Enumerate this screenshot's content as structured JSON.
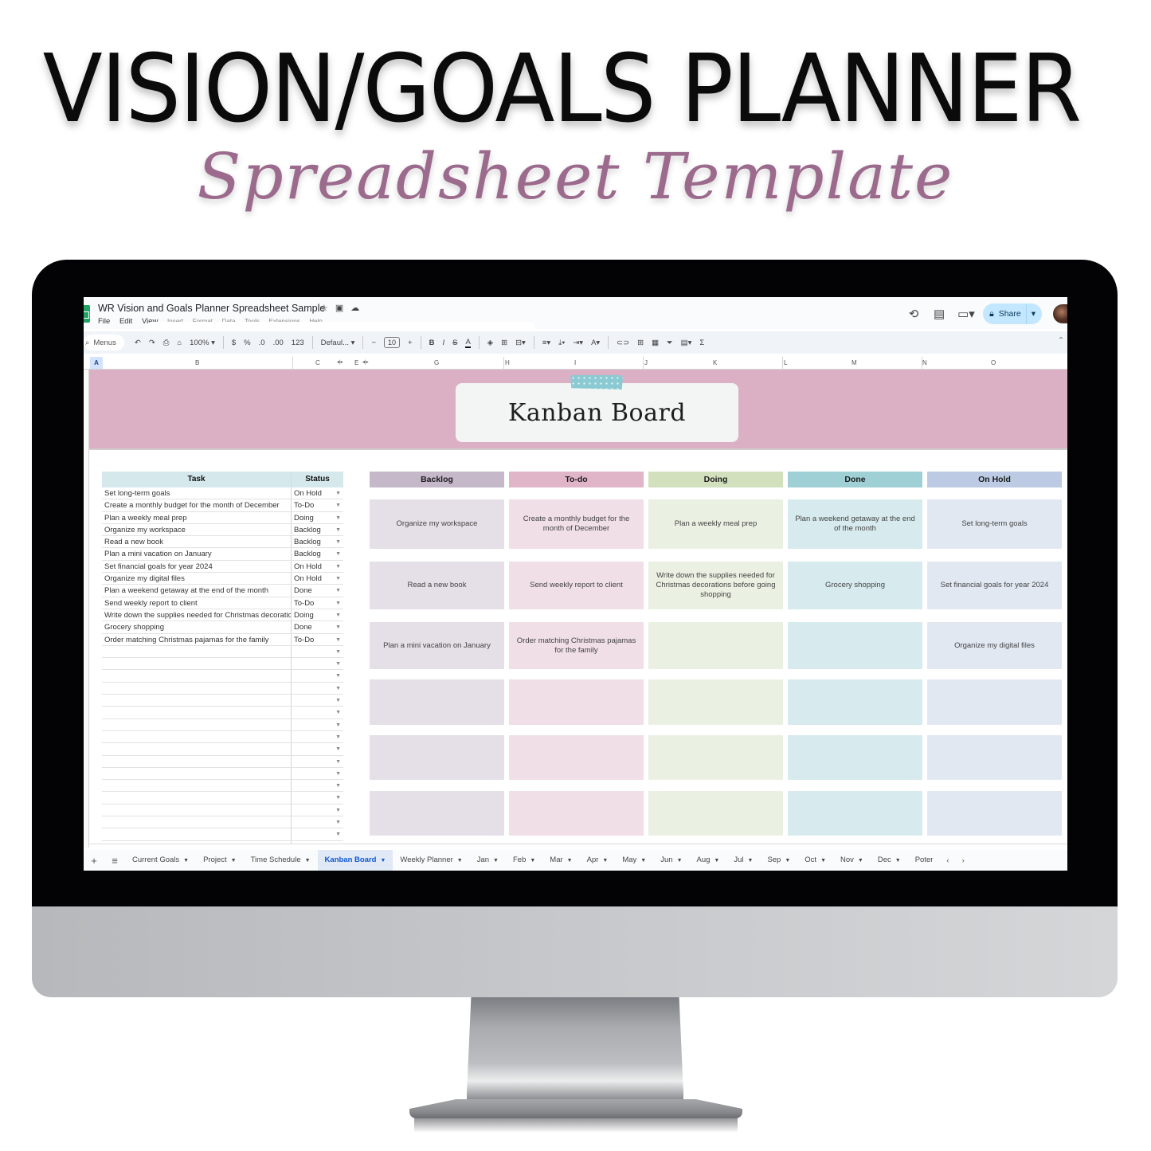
{
  "hero": {
    "title": "VISION/GOALS PLANNER",
    "subtitle": "Spreadsheet Template"
  },
  "app": {
    "doc_title": "WR Vision and Goals Planner Spreadsheet Sample",
    "title_icons": [
      "star-icon",
      "move-to-folder-icon",
      "cloud-status-icon"
    ],
    "menu": [
      "File",
      "Edit",
      "View",
      "Insert",
      "Format",
      "Data",
      "Tools",
      "Extensions",
      "Help"
    ],
    "share_label": "Share",
    "top_right_icons": [
      "version-history-icon",
      "comments-icon",
      "meet-icon"
    ]
  },
  "toolbar": {
    "search_label": "Menus",
    "zoom": "100%",
    "currency": "$",
    "percent": "%",
    "dec_decrease": ".0",
    "dec_increase": ".00",
    "number_format": "123",
    "font": "Defaul...",
    "font_size": "10",
    "bold": "B",
    "italic": "I",
    "strike": "S",
    "text_color": "A",
    "sigma": "Σ"
  },
  "columns": [
    "A",
    "B",
    "C",
    "E",
    "G",
    "H",
    "I",
    "J",
    "K",
    "L",
    "M",
    "N",
    "O"
  ],
  "banner": {
    "title": "Kanban Board",
    "bg_color": "#dcb0c4"
  },
  "task_table": {
    "headers": {
      "task": "Task",
      "status": "Status"
    },
    "rows": [
      {
        "task": "Set long-term goals",
        "status": "On Hold"
      },
      {
        "task": "Create a monthly budget for the month of December",
        "status": "To-Do"
      },
      {
        "task": "Plan a weekly meal prep",
        "status": "Doing"
      },
      {
        "task": "Organize my workspace",
        "status": "Backlog"
      },
      {
        "task": "Read a new book",
        "status": "Backlog"
      },
      {
        "task": "Plan a mini vacation on January",
        "status": "Backlog"
      },
      {
        "task": "Set financial goals for year 2024",
        "status": "On Hold"
      },
      {
        "task": "Organize my digital files",
        "status": "On Hold"
      },
      {
        "task": "Plan a weekend getaway at the end of the month",
        "status": "Done"
      },
      {
        "task": "Send weekly report to client",
        "status": "To-Do"
      },
      {
        "task": "Write down the supplies needed for Christmas decoratio",
        "status": "Doing"
      },
      {
        "task": "Grocery shopping",
        "status": "Done"
      },
      {
        "task": "Order matching Christmas pajamas for the family",
        "status": "To-Do"
      }
    ],
    "empty_rows": 17
  },
  "kanban": {
    "columns": [
      {
        "title": "Backlog",
        "header_color": "#c5b8c9",
        "card_color": "#e5dfe7",
        "cards": [
          "Organize my workspace",
          "Read a new book",
          "Plan a mini vacation on January",
          "",
          "",
          ""
        ]
      },
      {
        "title": "To-do",
        "header_color": "#e0b5c8",
        "card_color": "#f0dfe6",
        "cards": [
          "Create a monthly budget for the month of December",
          "Send weekly report to client",
          "Order matching Christmas pajamas for the family",
          "",
          "",
          ""
        ]
      },
      {
        "title": "Doing",
        "header_color": "#d3e0bd",
        "card_color": "#eaf0e2",
        "cards": [
          "Plan a weekly meal prep",
          "Write down the supplies needed for Christmas decorations before going shopping",
          "",
          "",
          "",
          ""
        ]
      },
      {
        "title": "Done",
        "header_color": "#9fd0d5",
        "card_color": "#d7eaed",
        "cards": [
          "Plan a weekend getaway at the end of the month",
          "Grocery shopping",
          "",
          "",
          "",
          ""
        ]
      },
      {
        "title": "On Hold",
        "header_color": "#bccbe3",
        "card_color": "#e2e8f2",
        "cards": [
          "Set long-term goals",
          "Set financial goals for year 2024",
          "Organize my digital files",
          "",
          "",
          ""
        ]
      }
    ]
  },
  "sheet_tabs": {
    "add_label": "+",
    "list_label": "≡",
    "tabs": [
      "Current Goals",
      "Project",
      "Time Schedule",
      "Kanban Board",
      "Weekly Planner",
      "Jan",
      "Feb",
      "Mar",
      "Apr",
      "May",
      "Jun",
      "Aug",
      "Jul",
      "Sep",
      "Oct",
      "Nov",
      "Dec",
      "Poter"
    ],
    "active": "Kanban Board"
  }
}
